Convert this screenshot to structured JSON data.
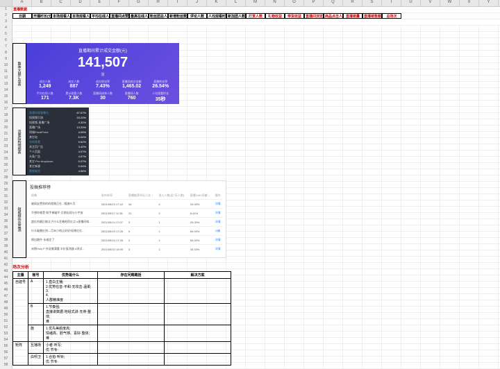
{
  "columns": [
    "",
    "A",
    "B",
    "C",
    "D",
    "E",
    "F",
    "G",
    "H",
    "I",
    "J",
    "K",
    "L",
    "M",
    "N",
    "O",
    "P",
    "Q",
    "R",
    "S",
    "T",
    "U",
    "V",
    "W",
    "X",
    "Y"
  ],
  "section1_title": "直播数据",
  "header_row1": [
    "日期",
    "开播时长(分钟)",
    "本场观看人数",
    "本场观看人次",
    "平均在线人数",
    "直播间点赞数",
    "最高在线人数",
    "粉丝团总人数",
    "新增粉丝数",
    "评论人数",
    "人均观看时长",
    "新加团人数",
    "打赏人数",
    "礼物收益",
    "带货收益",
    "直播间浏览量",
    "商品点击人数",
    "直播销量",
    "直播销售额",
    "总场次"
  ],
  "header_red_start": 12,
  "sidebar_labels": {
    "l1": "整体大屏汇总表",
    "l2": "流量结构明细表",
    "l3": "短视频作品监测"
  },
  "purple": {
    "title": "直播期间累计成交金额(元)",
    "big": "141,507",
    "sub": "涨",
    "metrics_row1": [
      {
        "lbl": "成交人数",
        "val": "1,249"
      },
      {
        "lbl": "成交人数",
        "val": "887"
      },
      {
        "lbl": "成交转化率",
        "val": "7.43%"
      },
      {
        "lbl": "直播间成交金额",
        "val": "1,465.02"
      },
      {
        "lbl": "直播转化率",
        "val": "26.54%"
      }
    ],
    "metrics_row2": [
      {
        "lbl": "平均在线人数",
        "val": "171"
      },
      {
        "lbl": "累计观看人数",
        "val": "7.3K"
      },
      {
        "lbl": "直播间成单人数",
        "val": "30"
      },
      {
        "lbl": "直播间人数",
        "val": "760"
      },
      {
        "lbl": "人均观看时长",
        "val": "35秒"
      }
    ]
  },
  "dark": {
    "rows": [
      {
        "k": "直播间观看曝光",
        "v": "87.67%",
        "hl": true
      },
      {
        "k": "短视频引流",
        "v": "33.20%"
      },
      {
        "k": "短视频-直播广场",
        "v": "4.32%"
      },
      {
        "k": "直播广场",
        "v": "13.20%"
      },
      {
        "k": "同城Feed/Feed",
        "v": "4.05%"
      },
      {
        "k": "其它站",
        "v": "6.04%"
      },
      {
        "k": "非粉观看",
        "v": "9.62%",
        "hl": true
      },
      {
        "k": "关注页广告",
        "v": "3.42%"
      },
      {
        "k": "个人页面",
        "v": "4.07%"
      },
      {
        "k": "头条广告",
        "v": "4.07%"
      },
      {
        "k": "其它·Pro·dropdown",
        "v": "0.07%"
      },
      {
        "k": "其它来源",
        "v": "0.04%"
      },
      {
        "k": "数据概览",
        "v": "4.56%",
        "hl": true
      }
    ]
  },
  "white": {
    "title": "投稿推荐榜",
    "cols": [
      "投稿",
      "发布时间",
      "直播推荐评论人次 ↓",
      "进入人数(近7天人数)",
      "直播GMV贡献 ↓",
      "操作"
    ],
    "rows": [
      {
        "t": "被网友赞到的的视频正在...随放叶月",
        "d": "2021/05/23 17:42",
        "a": "16",
        "b": "4",
        "c": "20.00%",
        "op": "详情"
      },
      {
        "t": "不想你难受·联手做破坏·日期出现与小宇宙",
        "d": "2021/05/17 11:36",
        "a": "21",
        "b": "2",
        "c": "6.41%",
        "op": "详情"
      },
      {
        "t": "超红的最后做太子什么狂嘲吧药红点 #直播间知...",
        "d": "2021/05/14 17:07",
        "a": "3",
        "b": "1",
        "c": "20.00%",
        "op": "详情"
      },
      {
        "t": "什么破圈红热—月末小地让好好!如果红红...",
        "d": "2021/05/19 17:05",
        "a": "5",
        "b": "1",
        "c": "60.00%",
        "op": "2/编"
      },
      {
        "t": "倒出散件·永难定了",
        "d": "2021/05/24 17:26",
        "a": "2",
        "b": "1",
        "c": "50.00%",
        "op": "详情"
      },
      {
        "t": "米倒Holy P 外说美满重 半价复测器 #测试...",
        "d": "2021/05/22 15:59",
        "a": "3",
        "b": "1",
        "c": "33.33%",
        "op": "详情"
      }
    ]
  },
  "section2_title": "场次分析",
  "lower": {
    "headers": [
      "主播",
      "账号",
      "优势是什么",
      "存在问题概括",
      "解决方案"
    ],
    "groups": [
      {
        "g": "自建号",
        "rows": [
          {
            "a": "A",
            "b": "1.直白主播;\n2.优势在音·平和·无攻击·温柔;\n3.\n4.\n人群精准度"
          },
          {
            "a": "B",
            "b": "1.节奏强;\n直接讲数据·地毯式讲·无停·整体;\n难"
          },
          {
            "a": "施",
            "b": "1.优先美颜度高;\n情绪高、胆气够、喜好·整体;\n难"
          }
        ]
      },
      {
        "g": "矩阵",
        "rows": [
          {
            "a": "互播场",
            "b": "小者·听写;\n优·节专·"
          },
          {
            "a": "白呗卫",
            "b": "1.合拍·听铃;\n优·节专·"
          }
        ]
      }
    ]
  }
}
